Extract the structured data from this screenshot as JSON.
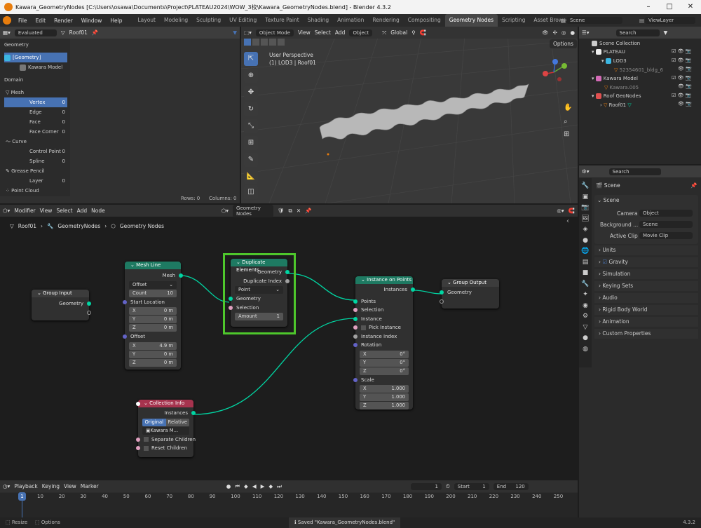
{
  "window": {
    "title": "Kawara_GeometryNodes [C:\\Users\\osawa\\Documents\\Project\\PLATEAU2024\\WOW_3校\\Kawara_GeometryNodes.blend] - Blender 4.3.2"
  },
  "menu": [
    "File",
    "Edit",
    "Render",
    "Window",
    "Help"
  ],
  "workspaces": [
    "Layout",
    "Modeling",
    "Sculpting",
    "UV Editing",
    "Texture Paint",
    "Shading",
    "Animation",
    "Rendering",
    "Compositing",
    "Geometry Nodes",
    "Scripting",
    "Asset Browser"
  ],
  "workspace_active": "Geometry Nodes",
  "scene_field": "Scene",
  "viewlayer_field": "ViewLayer",
  "spreadsheet": {
    "mode": "Evaluated",
    "object": "Roof01",
    "geometry_header": "Geometry",
    "geometry_item": "[Geometry]",
    "model_item": "Kawara Model",
    "domain_header": "Domain",
    "mesh": "Mesh",
    "domains": [
      {
        "name": "Vertex",
        "count": "0"
      },
      {
        "name": "Edge",
        "count": "0"
      },
      {
        "name": "Face",
        "count": "0"
      },
      {
        "name": "Face Corner",
        "count": "0"
      }
    ],
    "curve": "Curve",
    "curve_items": [
      {
        "name": "Control Point",
        "count": "0"
      },
      {
        "name": "Spline",
        "count": "0"
      }
    ],
    "grease": "Grease Pencil",
    "grease_items": [
      {
        "name": "Layer",
        "count": "0"
      }
    ],
    "pointcloud": "Point Cloud",
    "rows": "Rows: 0",
    "columns": "Columns: 0"
  },
  "viewport": {
    "mode": "Object Mode",
    "menus": [
      "View",
      "Select",
      "Add",
      "Object"
    ],
    "orientation": "Global",
    "options": "Options",
    "title": "User Perspective",
    "subtitle": "(1) LOD3 | Roof01"
  },
  "outliner": {
    "search": "Search",
    "items": [
      {
        "label": "Scene Collection",
        "indent": 0
      },
      {
        "label": "PLATEAU",
        "indent": 1
      },
      {
        "label": "LOD3",
        "indent": 2
      },
      {
        "label": "52354601_bldg_6",
        "indent": 3
      },
      {
        "label": "Kawara Model",
        "indent": 1
      },
      {
        "label": "Kawara.005",
        "indent": 2
      },
      {
        "label": "Roof GeoNodes",
        "indent": 1
      },
      {
        "label": "Roof01",
        "indent": 2
      }
    ]
  },
  "properties": {
    "search": "Search",
    "scene_title": "Scene",
    "section": "Scene",
    "camera_label": "Camera",
    "camera_ph": "Object",
    "bg_label": "Background ...",
    "bg_ph": "Scene",
    "clip_label": "Active Clip",
    "clip_ph": "Movie Clip",
    "panels": [
      "Units",
      "Gravity",
      "Simulation",
      "Keying Sets",
      "Audio",
      "Rigid Body World",
      "Animation",
      "Custom Properties"
    ]
  },
  "node_editor": {
    "editor": "Modifier",
    "menus": [
      "View",
      "Select",
      "Add",
      "Node"
    ],
    "tree": "Geometry Nodes",
    "breadcrumb": [
      "Roof01",
      "GeometryNodes",
      "Geometry Nodes"
    ]
  },
  "nodes": {
    "group_input": {
      "title": "Group Input",
      "out": "Geometry"
    },
    "mesh_line": {
      "title": "Mesh Line",
      "out": "Mesh",
      "mode": "Offset",
      "count_label": "Count",
      "count": "10",
      "start": "Start Location",
      "sx": "0 m",
      "sy": "0 m",
      "sz": "0 m",
      "offset": "Offset",
      "ox": "4.9 m",
      "oy": "0 m",
      "oz": "0 m"
    },
    "duplicate": {
      "title": "Duplicate Elements",
      "out1": "Geometry",
      "out2": "Duplicate Index",
      "domain": "Point",
      "in1": "Geometry",
      "in2": "Selection",
      "amount_label": "Amount",
      "amount": "1"
    },
    "instance": {
      "title": "Instance on Points",
      "out": "Instances",
      "points": "Points",
      "selection": "Selection",
      "instance": "Instance",
      "pick": "Pick Instance",
      "index": "Instance Index",
      "rotation": "Rotation",
      "rx": "0°",
      "ry": "0°",
      "rz": "0°",
      "scale": "Scale",
      "scx": "1.000",
      "scy": "1.000",
      "scz": "1.000"
    },
    "group_output": {
      "title": "Group Output",
      "in": "Geometry"
    },
    "collection": {
      "title": "Collection Info",
      "out": "Instances",
      "original": "Original",
      "relative": "Relative",
      "coll": "Kawara M...",
      "separate": "Separate Children",
      "reset": "Reset Children"
    }
  },
  "timeline": {
    "menus": [
      "Playback",
      "Keying",
      "View",
      "Marker"
    ],
    "frame": "1",
    "start_label": "Start",
    "start": "1",
    "end_label": "End",
    "end": "120",
    "ticks": [
      "10",
      "20",
      "30",
      "40",
      "50",
      "60",
      "70",
      "80",
      "90",
      "100",
      "110",
      "120",
      "130",
      "140",
      "150",
      "160",
      "170",
      "180",
      "190",
      "200",
      "210",
      "220",
      "230",
      "240",
      "250"
    ]
  },
  "status": {
    "resize": "Resize",
    "options": "Options",
    "saved": "Saved \"Kawara_GeometryNodes.blend\"",
    "version": "4.3.2"
  }
}
